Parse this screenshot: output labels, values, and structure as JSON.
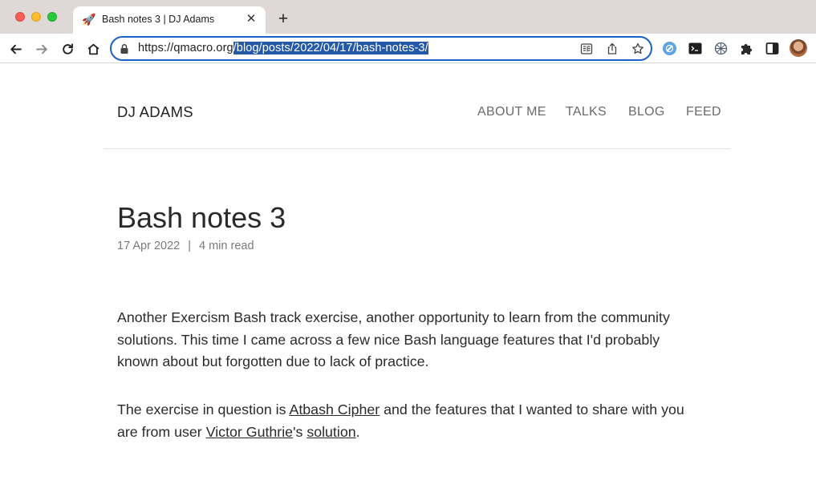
{
  "browser": {
    "tab": {
      "favicon": "🚀",
      "title": "Bash notes 3 | DJ Adams",
      "close": "✕"
    },
    "new_tab": "+",
    "address": {
      "host": "https://qmacro.org",
      "path": "/blog/posts/2022/04/17/bash-notes-3/"
    },
    "icons": {
      "back": "back-arrow-icon",
      "forward": "forward-arrow-icon",
      "reload": "reload-icon",
      "home": "home-icon",
      "lock": "lock-icon",
      "reader": "reader-mode-icon",
      "share": "share-icon",
      "bookmark": "star-icon"
    },
    "extensions": [
      "extension-icon",
      "terminal-icon",
      "network-icon",
      "puzzle-icon",
      "sidepanel-icon",
      "profile-avatar"
    ]
  },
  "site": {
    "name": "DJ ADAMS",
    "nav": [
      "ABOUT ME",
      "TALKS",
      "BLOG",
      "FEED"
    ]
  },
  "post": {
    "title": "Bash notes 3",
    "date": "17 Apr 2022",
    "separator": "|",
    "read_time": "4 min read",
    "p1_line1": "Another Exercism Bash track exercise, another opportunity to learn from the community",
    "p1_line2": "solutions. This time I came across a few nice Bash language features that I'd probably",
    "p1_line3": "known about but forgotten due to lack of practice.",
    "p2_text1": "The exercise in question is ",
    "p2_link1": "Atbash Cipher",
    "p2_text2": " and the features that I wanted to share with you",
    "p2_text3": "are from user ",
    "p2_link2": "Victor Guthrie",
    "p2_text4": "'s ",
    "p2_link3": "solution",
    "p2_text5": "."
  }
}
